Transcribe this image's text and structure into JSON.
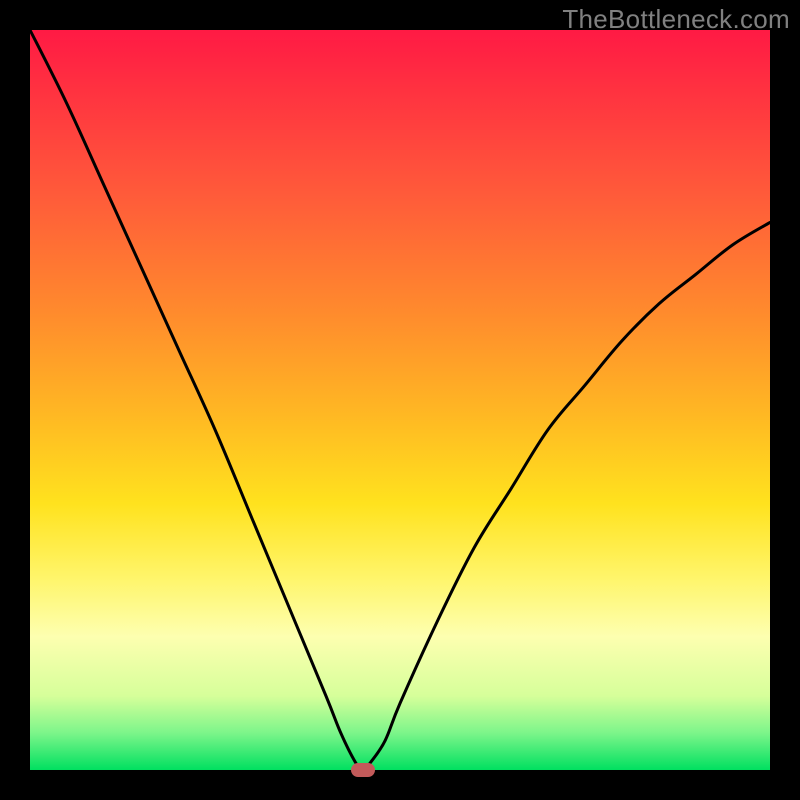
{
  "watermark": "TheBottleneck.com",
  "chart_data": {
    "type": "line",
    "title": "",
    "xlabel": "",
    "ylabel": "",
    "xlim": [
      0,
      100
    ],
    "ylim": [
      0,
      100
    ],
    "grid": false,
    "legend": false,
    "series": [
      {
        "name": "bottleneck-curve",
        "x": [
          0,
          5,
          10,
          15,
          20,
          25,
          30,
          35,
          40,
          42,
          44,
          45,
          46,
          48,
          50,
          55,
          60,
          65,
          70,
          75,
          80,
          85,
          90,
          95,
          100
        ],
        "values": [
          100,
          90,
          79,
          68,
          57,
          46,
          34,
          22,
          10,
          5,
          1,
          0,
          1,
          4,
          9,
          20,
          30,
          38,
          46,
          52,
          58,
          63,
          67,
          71,
          74
        ]
      }
    ],
    "marker": {
      "x": 45,
      "y": 0,
      "color": "#c25a5a"
    },
    "background_gradient": {
      "top": "#ff1a44",
      "bottom": "#00e060"
    }
  }
}
